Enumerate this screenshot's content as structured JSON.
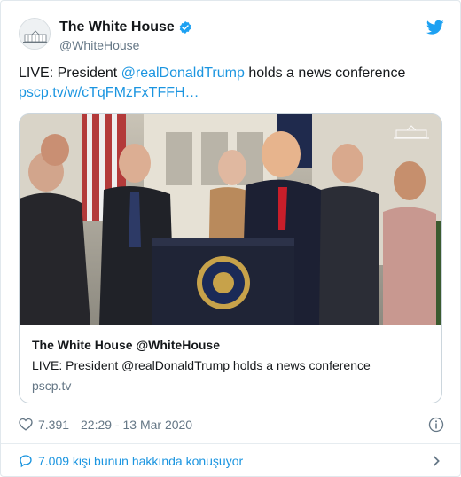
{
  "account": {
    "display_name": "The White House",
    "handle": "@WhiteHouse",
    "verified": true
  },
  "tweet": {
    "text_prefix": "LIVE: President ",
    "mention": "@realDonaldTrump",
    "text_suffix": " holds a news conference",
    "link": "pscp.tv/w/cTqFMzFxTFFH…"
  },
  "card": {
    "image_description": "",
    "title": "The White House @WhiteHouse",
    "description": "LIVE: President @realDonaldTrump holds a news conference",
    "domain": "pscp.tv"
  },
  "stats": {
    "likes": "7.391",
    "timestamp": "22:29 - 13 Mar 2020"
  },
  "conversation": {
    "label": "7.009 kişi bunun hakkında konuşuyor"
  },
  "colors": {
    "link": "#1b95e0",
    "verified": "#1da1f2",
    "text_primary": "#14171a",
    "text_secondary": "#657786"
  },
  "icons": [
    "white-house-avatar-icon",
    "verified-badge-icon",
    "twitter-bird-icon",
    "heart-icon",
    "info-icon",
    "speech-bubble-icon",
    "chevron-right-icon",
    "white-house-watermark-icon",
    "presidential-seal-icon"
  ]
}
